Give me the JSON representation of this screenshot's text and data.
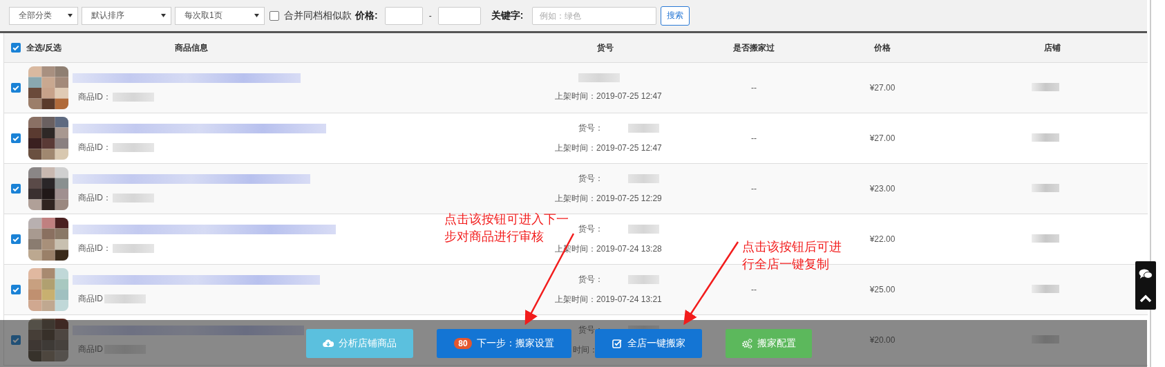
{
  "filters": {
    "selects": [
      {
        "value": "全部分类"
      },
      {
        "value": "默认排序"
      },
      {
        "value": "每次取1页"
      }
    ],
    "merge_similar": {
      "label": "合并同档相似款",
      "checked": false
    },
    "price_label": "价格:",
    "price_separator": "-",
    "keyword_label": "关键字:",
    "keyword": {
      "placeholder": "例如：绿色"
    },
    "search_button": "搜索"
  },
  "table": {
    "select_all": {
      "label": "全选/反选",
      "checked": true
    },
    "columns": [
      "商品信息",
      "货号",
      "是否搬家过",
      "价格",
      "店铺"
    ],
    "rows": [
      {
        "checked": true,
        "goods_id_label": "商品ID：",
        "listed_time": "上架时间：2019-07-25 12:47",
        "moved": "--",
        "price": "¥27.00"
      },
      {
        "checked": true,
        "goods_id_label": "商品ID：",
        "sku_label": "货号：",
        "listed_time": "上架时间：2019-07-25 12:47",
        "moved": "--",
        "price": "¥27.00"
      },
      {
        "checked": true,
        "goods_id_label": "商品ID：",
        "sku_label": "货号：",
        "listed_time": "上架时间：2019-07-25 12:29",
        "moved": "--",
        "price": "¥23.00"
      },
      {
        "checked": true,
        "goods_id_label": "商品ID：",
        "sku_label": "货号：",
        "listed_time": "上架时间：2019-07-24 13:28",
        "price": "¥22.00"
      },
      {
        "checked": true,
        "goods_id_label": "商品ID",
        "sku_label": "货号：",
        "listed_time": "上架时间：2019-07-24 13:21",
        "moved": "--",
        "price": "¥25.00"
      },
      {
        "checked": true,
        "goods_id_label": "商品ID",
        "sku_label": "货号：",
        "listed_time": "时间：",
        "price": "¥20.00"
      }
    ]
  },
  "action_bar": [
    {
      "kind": "analyze",
      "label": "分析店铺商品"
    },
    {
      "kind": "next",
      "label": "下一步：搬家设置",
      "badge": "80"
    },
    {
      "kind": "copy_all",
      "label": "全店一键搬家"
    },
    {
      "kind": "config",
      "label": "搬家配置"
    }
  ],
  "annotations": [
    {
      "lines": [
        "点击该按钮可进入下一",
        "步对商品进行审核"
      ]
    },
    {
      "lines": [
        "点击该按钮后可进",
        "行全店一键复制"
      ]
    }
  ]
}
